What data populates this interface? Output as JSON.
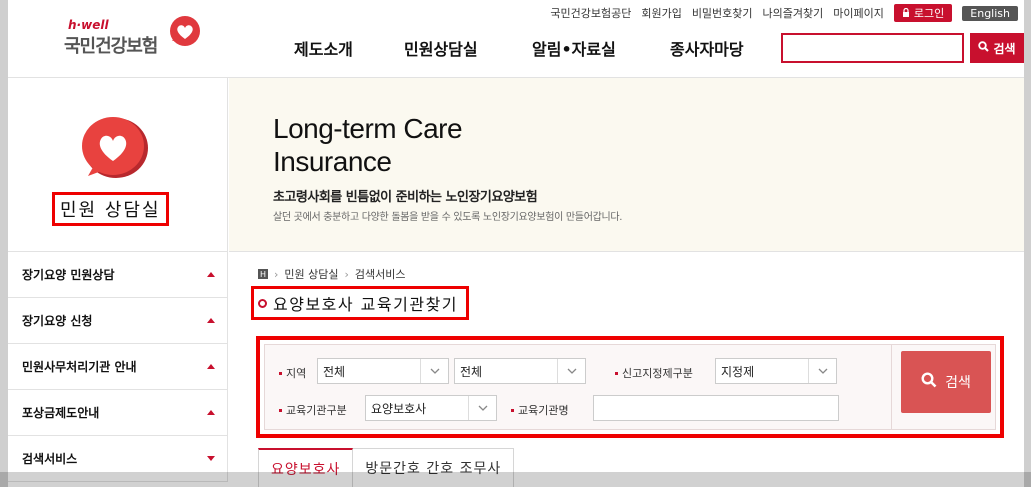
{
  "header": {
    "logo_sub": "h·well",
    "logo_name": "국민건강보험",
    "util": [
      "국민건강보험공단",
      "회원가입",
      "비밀번호찾기",
      "나의즐겨찾기",
      "마이페이지"
    ],
    "login_label": "로그인",
    "english_label": "English",
    "gnb": [
      "제도소개",
      "민원상담실",
      "알림•자료실",
      "종사자마당"
    ],
    "search_placeholder": "",
    "search_button": "검색"
  },
  "left": {
    "section_title": "민원 상담실",
    "menu": [
      {
        "label": "장기요양 민원상담",
        "expanded": false
      },
      {
        "label": "장기요양 신청",
        "expanded": false
      },
      {
        "label": "민원사무처리기관 안내",
        "expanded": false
      },
      {
        "label": "포상금제도안내",
        "expanded": false
      },
      {
        "label": "검색서비스",
        "expanded": true
      }
    ]
  },
  "banner": {
    "line1": "Long-term Care",
    "line2": "Insurance",
    "headline": "초고령사회를 빈틈없이 준비하는 노인장기요양보험",
    "subline": "살던 곳에서 충분하고 다양한 돌봄을 받을 수 있도록 노인장기요양보험이 만들어갑니다."
  },
  "breadcrumb": {
    "home": "H",
    "items": [
      "민원 상담실",
      "검색서비스"
    ]
  },
  "page_title": "요양보호사 교육기관찾기",
  "filter": {
    "region_label": "지역",
    "region1": "전체",
    "region2": "전체",
    "report_label": "신고지정제구분",
    "report_value": "지정제",
    "inst_type_label": "교육기관구분",
    "inst_type_value": "요양보호사",
    "inst_name_label": "교육기관명",
    "inst_name_value": "",
    "search_button": "검색"
  },
  "tabs": [
    "요양보호사",
    "방문간호 간호 조무사"
  ],
  "colors": {
    "accent": "#c8102e",
    "search_btn": "#d95454",
    "highlight_box": "#ee0000"
  }
}
